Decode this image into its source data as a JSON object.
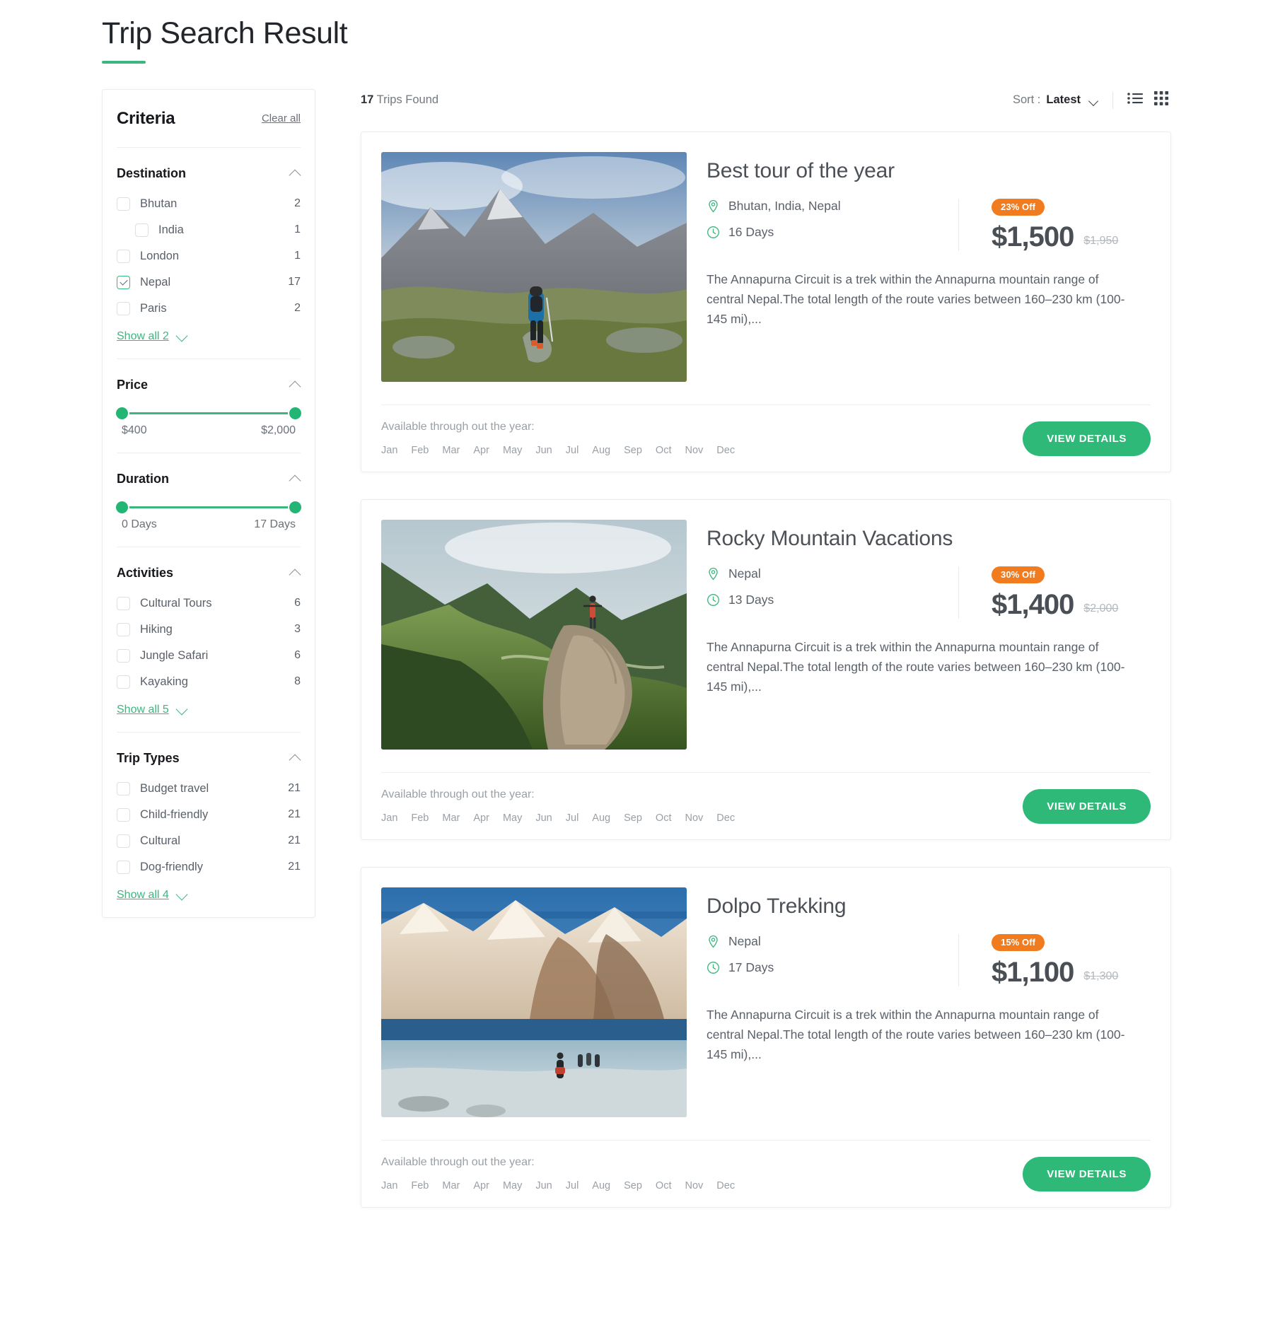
{
  "header": {
    "title": "Trip Search Result"
  },
  "sidebar": {
    "title": "Criteria",
    "clear_all": "Clear all",
    "facets": [
      {
        "name": "destination",
        "title": "Destination",
        "collapse_icon": "chevron-up-icon",
        "type": "checkboxes",
        "options": [
          {
            "label": "Bhutan",
            "count": "2",
            "checked": false,
            "indent": false
          },
          {
            "label": "India",
            "count": "1",
            "checked": false,
            "indent": true
          },
          {
            "label": "London",
            "count": "1",
            "checked": false,
            "indent": false
          },
          {
            "label": "Nepal",
            "count": "17",
            "checked": true,
            "indent": false
          },
          {
            "label": "Paris",
            "count": "2",
            "checked": false,
            "indent": false
          }
        ],
        "show_all": "Show all 2"
      },
      {
        "name": "price",
        "title": "Price",
        "collapse_icon": "chevron-up-icon",
        "type": "range",
        "min_label": "$400",
        "max_label": "$2,000"
      },
      {
        "name": "duration",
        "title": "Duration",
        "collapse_icon": "chevron-up-icon",
        "type": "range",
        "min_label": "0 Days",
        "max_label": "17 Days"
      },
      {
        "name": "activities",
        "title": "Activities",
        "collapse_icon": "chevron-up-icon",
        "type": "checkboxes",
        "options": [
          {
            "label": "Cultural Tours",
            "count": "6",
            "checked": false,
            "indent": false
          },
          {
            "label": "Hiking",
            "count": "3",
            "checked": false,
            "indent": false
          },
          {
            "label": "Jungle Safari",
            "count": "6",
            "checked": false,
            "indent": false
          },
          {
            "label": "Kayaking",
            "count": "8",
            "checked": false,
            "indent": false
          }
        ],
        "show_all": "Show all 5"
      },
      {
        "name": "trip-types",
        "title": "Trip Types",
        "collapse_icon": "chevron-up-icon",
        "type": "checkboxes",
        "options": [
          {
            "label": "Budget travel",
            "count": "21",
            "checked": false,
            "indent": false
          },
          {
            "label": "Child-friendly",
            "count": "21",
            "checked": false,
            "indent": false
          },
          {
            "label": "Cultural",
            "count": "21",
            "checked": false,
            "indent": false
          },
          {
            "label": "Dog-friendly",
            "count": "21",
            "checked": false,
            "indent": false
          }
        ],
        "show_all": "Show all 4"
      }
    ]
  },
  "toolbar": {
    "found_count": "17",
    "found_text": "Trips Found",
    "sort_label": "Sort :",
    "sort_value": "Latest",
    "sort_chevron_icon": "chevron-down-icon",
    "list_view_icon": "list-view-icon",
    "grid_view_icon": "grid-view-icon"
  },
  "common": {
    "availability_label": "Available through out the year:",
    "months": [
      "Jan",
      "Feb",
      "Mar",
      "Apr",
      "May",
      "Jun",
      "Jul",
      "Aug",
      "Sep",
      "Oct",
      "Nov",
      "Dec"
    ],
    "view_details_label": "VIEW DETAILS",
    "location_icon": "map-pin-icon",
    "duration_icon": "clock-icon"
  },
  "colors": {
    "accent_green": "#3bb77e",
    "button_green": "#2fb978",
    "badge_orange": "#f07c1f",
    "title_text": "#4c5157",
    "muted_text": "#9aa0a6"
  },
  "trips": [
    {
      "title": "Best tour of the year",
      "location": "Bhutan, India, Nepal",
      "duration": "16 Days",
      "discount": "23% Off",
      "price": "$1,500",
      "old_price": "$1,950",
      "description": "The Annapurna Circuit is a trek within the Annapurna mountain range of central Nepal.The total length of the route varies between 160–230 km (100-145 mi),...",
      "image": "hiker-on-rocky-alpine-trail"
    },
    {
      "title": "Rocky Mountain Vacations",
      "location": "Nepal",
      "duration": "13 Days",
      "discount": "30% Off",
      "price": "$1,400",
      "old_price": "$2,000",
      "description": "The Annapurna Circuit is a trek within the Annapurna mountain range of central Nepal.The total length of the route varies between 160–230 km (100-145 mi),...",
      "image": "green-valley-cliff-viewpoint"
    },
    {
      "title": "Dolpo Trekking",
      "location": "Nepal",
      "duration": "17 Days",
      "discount": "15% Off",
      "price": "$1,100",
      "old_price": "$1,300",
      "description": "The Annapurna Circuit is a trek within the Annapurna mountain range of central Nepal.The total length of the route varies between 160–230 km (100-145 mi),...",
      "image": "trekkers-beside-mountain-lake"
    }
  ]
}
